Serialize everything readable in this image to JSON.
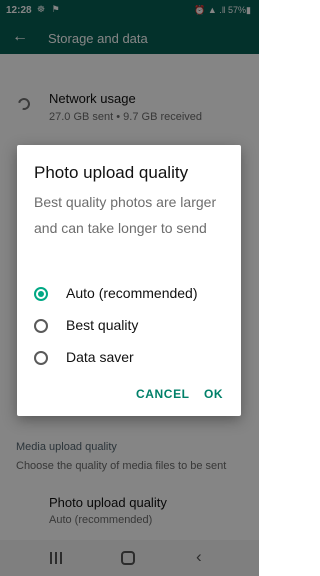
{
  "status_bar": {
    "time": "12:28",
    "left_icons": "☸ ⚑",
    "right_text": "⏰ ▲ .‖ 57%▮"
  },
  "app_bar": {
    "back_icon": "←",
    "title": "Storage and data"
  },
  "network": {
    "title": "Network usage",
    "subtitle": "27.0 GB sent • 9.7 GB received"
  },
  "media_section": {
    "header": "Media upload quality",
    "subtitle": "Choose the quality of media files to be sent",
    "photo_title": "Photo upload quality",
    "photo_value": "Auto (recommended)"
  },
  "dialog": {
    "title": "Photo upload quality",
    "body": "Best quality photos are larger and can take longer to send",
    "options": [
      {
        "label": "Auto (recommended)",
        "selected": true
      },
      {
        "label": "Best quality",
        "selected": false
      },
      {
        "label": "Data saver",
        "selected": false
      }
    ],
    "cancel_label": "CANCEL",
    "ok_label": "OK"
  },
  "nav": {
    "back_icon": "‹"
  },
  "colors": {
    "header": "#075e54",
    "accent": "#00a884",
    "button_text": "#008069"
  }
}
